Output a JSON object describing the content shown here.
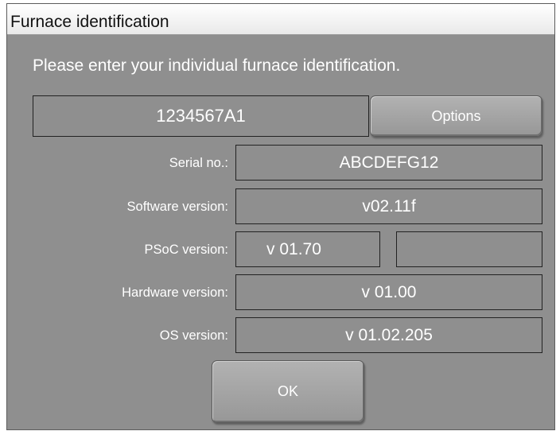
{
  "window": {
    "title": "Furnace identification"
  },
  "prompt": "Please enter your individual furnace identification.",
  "furnace_id": {
    "value": "1234567A1"
  },
  "options_button": "Options",
  "rows": [
    {
      "label": "Serial no.:",
      "value": "ABCDEFG12"
    },
    {
      "label": "Software version:",
      "value": "v02.11f"
    },
    {
      "label": "PSoC version:",
      "value": "v 01.70",
      "value2": ""
    },
    {
      "label": "Hardware version:",
      "value": "v 01.00"
    },
    {
      "label": "OS version:",
      "value": "v 01.02.205"
    }
  ],
  "ok_button": "OK",
  "colors": {
    "window_background": "#8f8f8f",
    "titlebar_background": "#f4f4f4",
    "text": "#ffffff",
    "field_border": "#222222"
  }
}
